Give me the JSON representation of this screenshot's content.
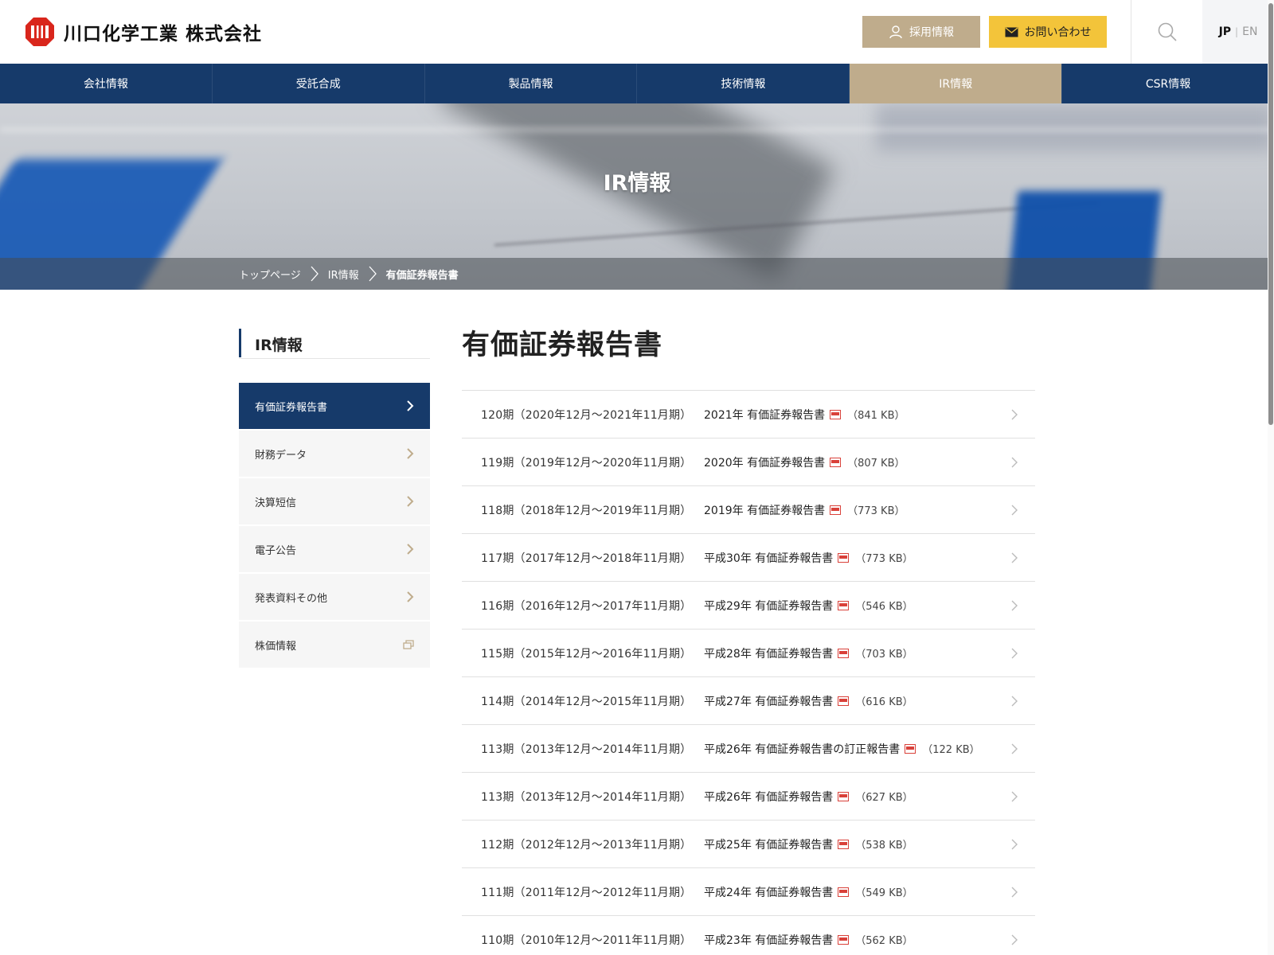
{
  "header": {
    "company_name": "川口化学工業 株式会社",
    "recruit_label": "採用情報",
    "contact_label": "お問い合わせ",
    "lang_jp": "JP",
    "lang_sep": "|",
    "lang_en": "EN"
  },
  "nav": {
    "items": [
      {
        "label": "会社情報",
        "active": false
      },
      {
        "label": "受託合成",
        "active": false
      },
      {
        "label": "製品情報",
        "active": false
      },
      {
        "label": "技術情報",
        "active": false
      },
      {
        "label": "IR情報",
        "active": true
      },
      {
        "label": "CSR情報",
        "active": false
      }
    ]
  },
  "hero": {
    "title": "IR情報",
    "breadcrumb": {
      "home": "トップページ",
      "section": "IR情報",
      "current": "有価証券報告書"
    }
  },
  "sidebar": {
    "title": "IR情報",
    "items": [
      {
        "label": "有価証券報告書",
        "active": true,
        "icon": "chevron-right-icon"
      },
      {
        "label": "財務データ",
        "active": false,
        "icon": "chevron-right-icon"
      },
      {
        "label": "決算短信",
        "active": false,
        "icon": "chevron-right-icon"
      },
      {
        "label": "電子公告",
        "active": false,
        "icon": "chevron-right-icon"
      },
      {
        "label": "発表資料その他",
        "active": false,
        "icon": "chevron-right-icon"
      },
      {
        "label": "株価情報",
        "active": false,
        "icon": "external-link-icon"
      }
    ]
  },
  "main": {
    "title": "有価証券報告書",
    "rows": [
      {
        "period": "120期（2020年12月～2021年11月期）",
        "doc": "2021年 有価証券報告書",
        "size": "（841 KB）"
      },
      {
        "period": "119期（2019年12月～2020年11月期）",
        "doc": "2020年 有価証券報告書",
        "size": "（807 KB）"
      },
      {
        "period": "118期（2018年12月～2019年11月期）",
        "doc": "2019年 有価証券報告書",
        "size": "（773 KB）"
      },
      {
        "period": "117期（2017年12月～2018年11月期）",
        "doc": "平成30年 有価証券報告書",
        "size": "（773 KB）"
      },
      {
        "period": "116期（2016年12月～2017年11月期）",
        "doc": "平成29年 有価証券報告書",
        "size": "（546 KB）"
      },
      {
        "period": "115期（2015年12月～2016年11月期）",
        "doc": "平成28年 有価証券報告書",
        "size": "（703 KB）"
      },
      {
        "period": "114期（2014年12月～2015年11月期）",
        "doc": "平成27年 有価証券報告書",
        "size": "（616 KB）"
      },
      {
        "period": "113期（2013年12月～2014年11月期）",
        "doc": "平成26年 有価証券報告書の訂正報告書",
        "size": "（122 KB）"
      },
      {
        "period": "113期（2013年12月～2014年11月期）",
        "doc": "平成26年 有価証券報告書",
        "size": "（627 KB）"
      },
      {
        "period": "112期（2012年12月～2013年11月期）",
        "doc": "平成25年 有価証券報告書",
        "size": "（538 KB）"
      },
      {
        "period": "111期（2011年12月～2012年11月期）",
        "doc": "平成24年 有価証券報告書",
        "size": "（549 KB）"
      },
      {
        "period": "110期（2010年12月～2011年11月期）",
        "doc": "平成23年 有価証券報告書",
        "size": "（562 KB）"
      }
    ]
  },
  "colors": {
    "navy": "#163a6a",
    "gold": "#bfac8c",
    "yellow": "#f3c43a",
    "pdf_red": "#d9413a"
  }
}
